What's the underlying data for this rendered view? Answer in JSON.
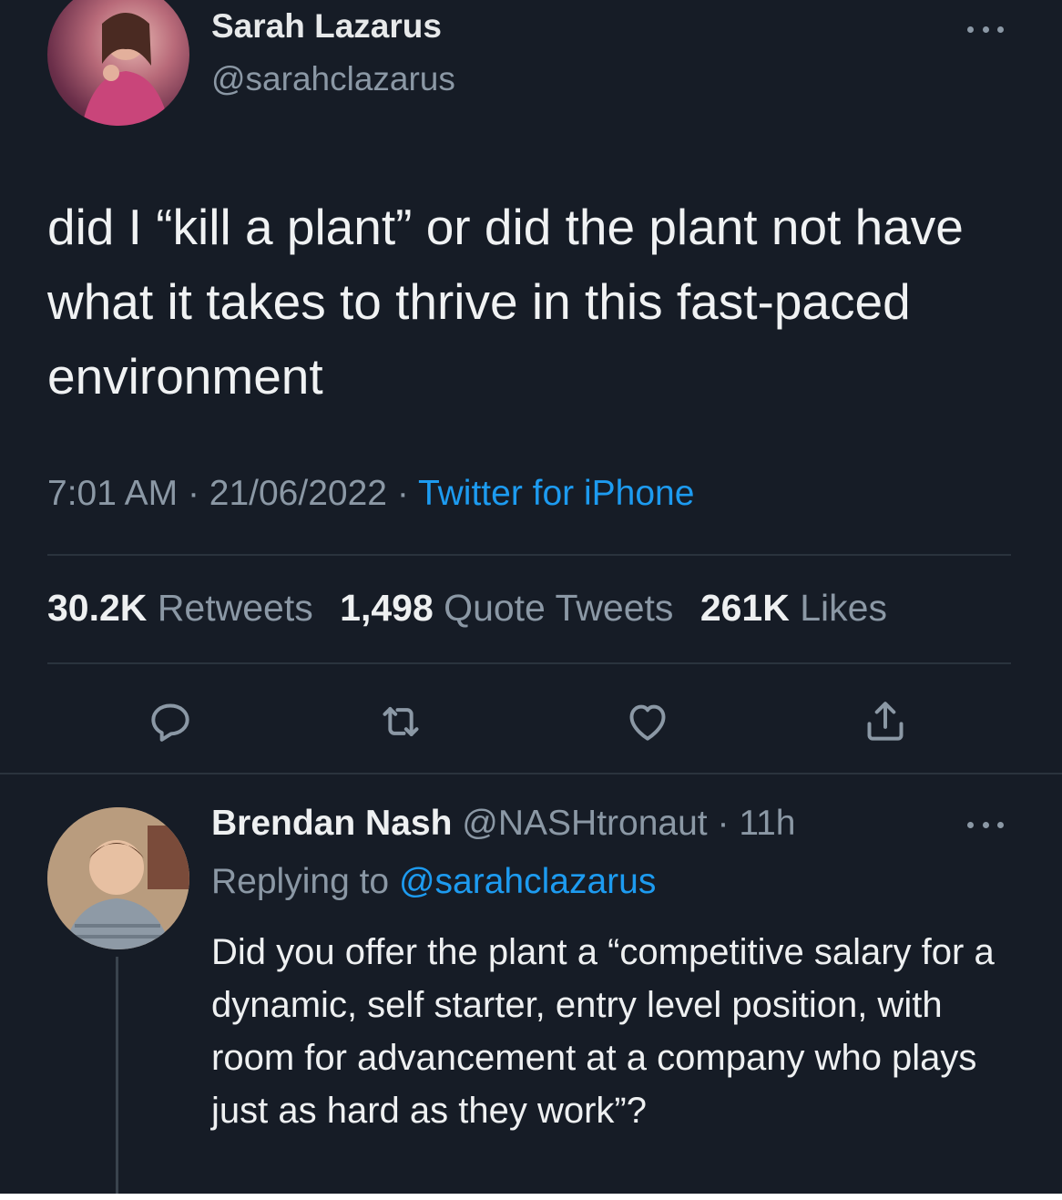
{
  "tweet": {
    "author_name": "Sarah Lazarus",
    "author_handle": "@sarahclazarus",
    "text": "did I “kill a plant” or did the plant not have what it takes to thrive in this fast-paced environment",
    "time": "7:01 AM",
    "date": "21/06/2022",
    "separator": "·",
    "source": "Twitter for iPhone",
    "stats": {
      "retweets_count": "30.2K",
      "retweets_label": "Retweets",
      "quotes_count": "1,498",
      "quotes_label": "Quote Tweets",
      "likes_count": "261K",
      "likes_label": "Likes"
    },
    "actions": [
      "reply-icon",
      "retweet-icon",
      "like-icon",
      "share-icon"
    ]
  },
  "reply": {
    "author_name": "Brendan Nash",
    "author_handle": "@NASHtronaut",
    "separator": "·",
    "age": "11h",
    "replying_prefix": "Replying to",
    "replying_to": "@sarahclazarus",
    "text": "Did you offer the plant a “competitive salary for a dynamic, self starter, entry level position, with room for advancement at a company who plays just as hard as they work”?"
  },
  "colors": {
    "background": "#161c26",
    "link": "#1d9bf0",
    "muted": "#8b98a5",
    "text": "#e7e9ea"
  }
}
